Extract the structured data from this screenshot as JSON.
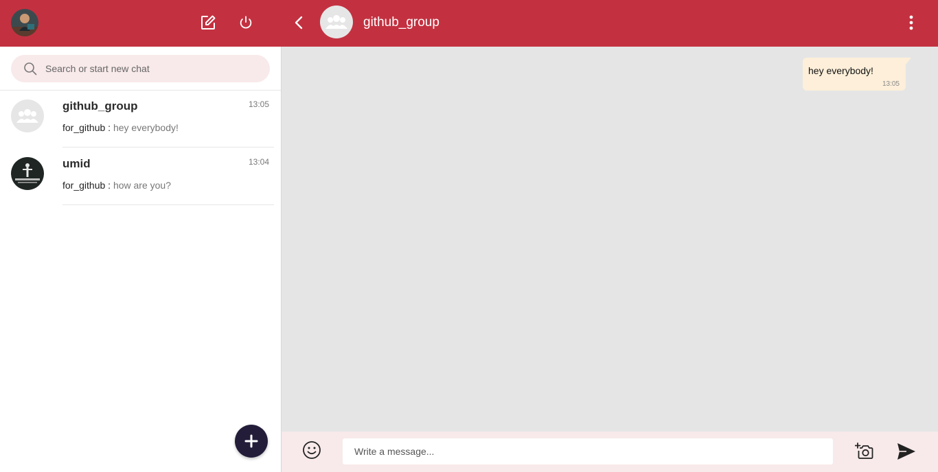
{
  "colors": {
    "accent": "#c33140",
    "search_bg": "#f8e9ea",
    "chat_bg": "#e5e5e5",
    "bubble_out": "#fdefd9",
    "fab": "#231d3a"
  },
  "sidebar": {
    "header": {
      "avatar_icon": "user-avatar-photo",
      "compose_icon": "edit-icon",
      "power_icon": "power-icon"
    },
    "search": {
      "placeholder": "Search or start new chat",
      "icon": "search-icon"
    },
    "chats": [
      {
        "name": "github_group",
        "time": "13:05",
        "sender": "for_github :",
        "message": "hey everybody!",
        "avatar_icon": "group-icon"
      },
      {
        "name": "umid",
        "time": "13:04",
        "sender": "for_github :",
        "message": "how are you?",
        "avatar_icon": "user-avatar-photo"
      }
    ],
    "fab_icon": "plus-icon"
  },
  "conversation": {
    "title": "github_group",
    "back_icon": "chevron-left-icon",
    "avatar_icon": "group-icon",
    "menu_icon": "more-vertical-icon",
    "messages": [
      {
        "text": "hey everybody!",
        "time": "13:05",
        "direction": "outgoing"
      }
    ],
    "composer": {
      "placeholder": "Write a message...",
      "emoji_icon": "emoji-icon",
      "camera_icon": "camera-add-icon",
      "send_icon": "send-icon"
    }
  }
}
